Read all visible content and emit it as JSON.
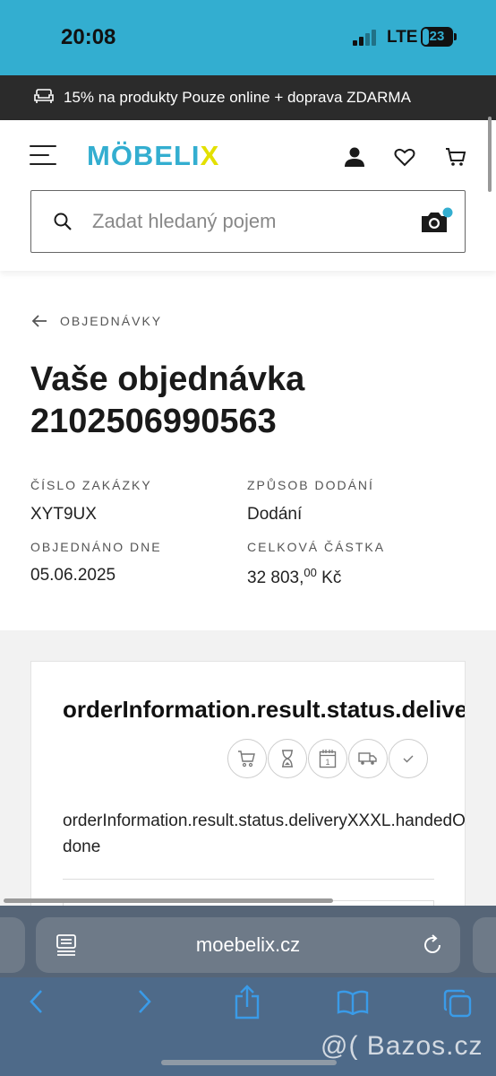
{
  "status_bar": {
    "time": "20:08",
    "network": "LTE",
    "battery": "23",
    "battery_level": 0.23
  },
  "promo": {
    "text": "15% na produkty Pouze online + doprava ZDARMA"
  },
  "header": {
    "logo_main": "MÖBELI",
    "logo_accent": "X",
    "search_placeholder": "Zadat hledaný pojem"
  },
  "order": {
    "back_label": "OBJEDNÁVKY",
    "title_line1": "Vaše objednávka",
    "title_line2": "2102506990563",
    "fields": {
      "order_number_label": "ČÍSLO ZAKÁZKY",
      "order_number_value": "XYT9UX",
      "delivery_method_label": "ZPŮSOB DODÁNÍ",
      "delivery_method_value": "Dodání",
      "ordered_on_label": "OBJEDNÁNO DNE",
      "ordered_on_value": "05.06.2025",
      "total_label": "CELKOVÁ ČÁSTKA",
      "total_main": "32 803,",
      "total_cents": "00",
      "total_currency": " Kč"
    }
  },
  "status_card": {
    "title": "orderInformation.result.status.delivered",
    "steps": [
      {
        "icon": "cart-icon"
      },
      {
        "icon": "hourglass-icon"
      },
      {
        "icon": "calendar-icon",
        "label": "1"
      },
      {
        "icon": "truck-icon"
      },
      {
        "icon": "check-icon"
      }
    ],
    "text_line1": "orderInformation.result.status.deliveryXXXL.handedOver",
    "text_line2": "done"
  },
  "browser": {
    "url": "moebelix.cz"
  },
  "watermark": "@( Bazos.cz",
  "colors": {
    "accent": "#33aed0",
    "logo_x": "#e3e000",
    "promo_bg": "#2b2b2b",
    "browser_bg": "#4e6a89"
  }
}
